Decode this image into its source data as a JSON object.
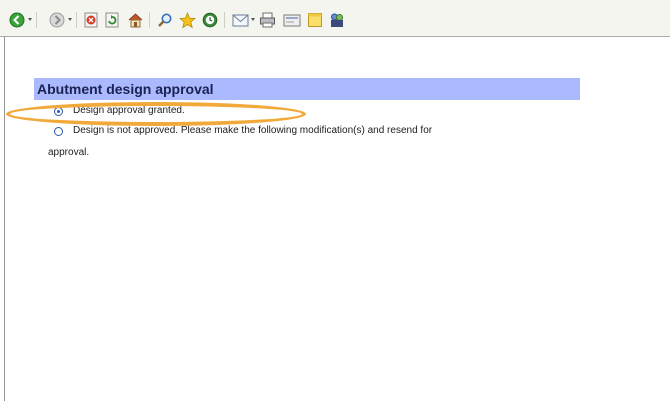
{
  "toolbar": {
    "icons": [
      "back-icon",
      "forward-icon",
      "stop-icon",
      "refresh-icon",
      "home-icon",
      "search-icon",
      "favorites-icon",
      "history-icon",
      "mail-icon",
      "print-icon",
      "edit-icon",
      "discuss-icon",
      "messenger-icon"
    ]
  },
  "section": {
    "title": "Abutment design approval"
  },
  "options": [
    {
      "label": "Design approval granted.",
      "selected": true
    },
    {
      "label_line1": "Design is not approved. Please make the following modification(s) and resend for",
      "label_line2": "approval.",
      "selected": false
    }
  ],
  "colors": {
    "header_bg": "#abb9ff",
    "highlight": "#f2a93b",
    "radio": "#2b5aa8"
  }
}
